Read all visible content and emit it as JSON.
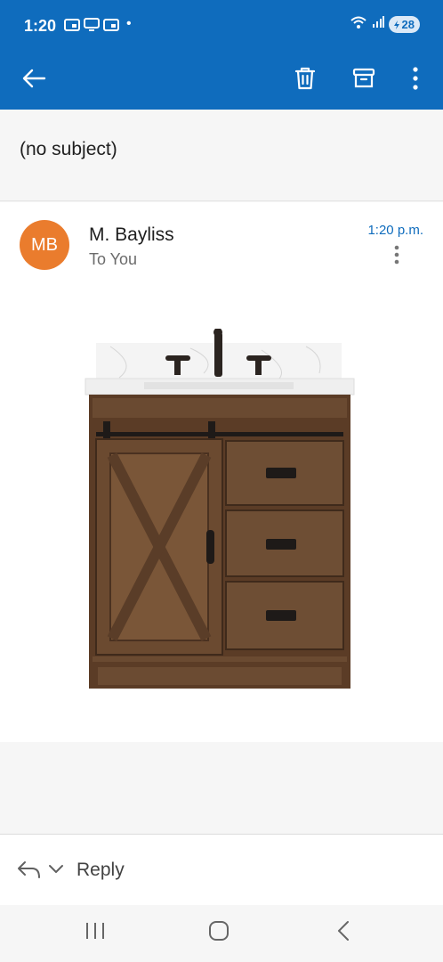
{
  "status_bar": {
    "time": "1:20",
    "dot": "•",
    "battery_level": "28",
    "icons": [
      "notification-icon",
      "cast-icon",
      "notification-icon",
      "wifi-icon",
      "signal-icon",
      "battery-icon"
    ]
  },
  "app_bar": {
    "icons": [
      "back-arrow-icon",
      "trash-icon",
      "archive-icon",
      "more-vertical-icon"
    ]
  },
  "email": {
    "subject": "(no subject)",
    "sender_initials": "MB",
    "sender_name": "M. Bayliss",
    "recipient": "To You",
    "time": "1:20 p.m."
  },
  "reply": {
    "label": "Reply"
  },
  "colors": {
    "accent": "#0f6cbd",
    "avatar": "#ea7c2d"
  }
}
